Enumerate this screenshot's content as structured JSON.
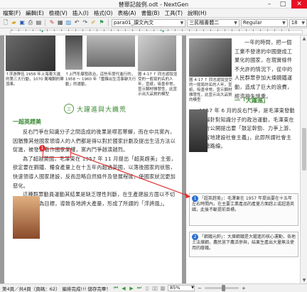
{
  "window": {
    "title": "替罪記敍例.odt - NextGen",
    "minimize": "–",
    "maximize": "□",
    "close": "✕"
  },
  "menu": [
    "檔案(F)",
    "編輯(E)",
    "檢視(V)",
    "插入(I)",
    "格式(O)",
    "表格(A)",
    "書籤(B)",
    "工具(T)",
    "說明(H)"
  ],
  "toolbar": {
    "style_value": "para01_課文內文",
    "font_value": "三民楷書體二",
    "weight_value": "Regular",
    "size_value": "18"
  },
  "document": {
    "caption_left_1": "↑浮游隊伍 1958 年上海東大進的第三大行動，1070 萬噸鋼的華頂車。",
    "caption_left_2": "↑上門冬爆發政治，這些年度代進行的，1958 ～ 1960 年「雷鋒出生活事跡大行動」的運動，",
    "caption_right_1": "圖 4-17 ↑ 同志遊說並受的一般寫的名的人年，宣紙，吸墨非常。宣示鋼材雅慧性，此宣示出大品質的模型",
    "section_number": "三",
    "section_title": "大躍進與大饑荒",
    "subhead": "一超英趕美",
    "paragraphs": [
      "反右鬥爭在知識分子之間造成的後果是噤若寒蟬，而在中共黨內，因猶豫其他國家領導人的人們都是得以對於國家計劃及提出生活方法以促進，被發及看作國家業權，黨內鬥爭越演越烈。",
      "為了超越英國，毛澤東在 1957 年 11 月提出「超英趕美」主張，欲定要在鋼鐵、糧食產量上在十五年內超過英國，以落後國家的狀態，快速領導人國家建設，反而忽略自然條件及發展程度，使國家狀況更加惡化。",
      "這種群眾動員運動其結果是缺乏理性判斷，在生產建設方面以不切實際的數字為目標，導致各地誇大產量，形成了所謂的「浮誇風」。"
    ],
    "highlight_text": "超英趕美",
    "right_text": [
      "一年的時間，把一個工業不發達的中國變成工業化的國家，在現實條件不允許的情況下，從中的人民群眾參加大煉鋼鐵運動，造成了巨大的浪費，經濟損失慘重。",
      "一「大躍進」",
      "1957 年 6 月的反右鬥爭，是毛澤東發動的第一場針對知識分子的政治運動，毛澤東在多個場合公開提出要「鼓足幹勁、力爭上游、多快好省地建設社會主義」，此即所謂社會主義建設總路線。"
    ],
    "note_1": "「超英趕美」：毛澤東在 1957 年提出要在十五年左右時間內，在主要工業產品的產量方面趕上或超過英國，此後不斷提前目標。",
    "note_2": "「鋼鐵元帥」：大煉鋼鐵是大躍進的核心運動，各地土法煉鋼，農民放下農活參與，結果生產出大量無法使用的廢鐵。"
  },
  "status": {
    "page_info": "第4頁／共4頁（頁碼：62）",
    "save_state": "編排完成!!! 儲存完畢！",
    "zoom": "85%",
    "zoom_fraction": 0.55
  },
  "colors": {
    "accent_green": "#3d8a35",
    "highlight_red": "#e03030",
    "note_blue": "#2a6fd0"
  }
}
